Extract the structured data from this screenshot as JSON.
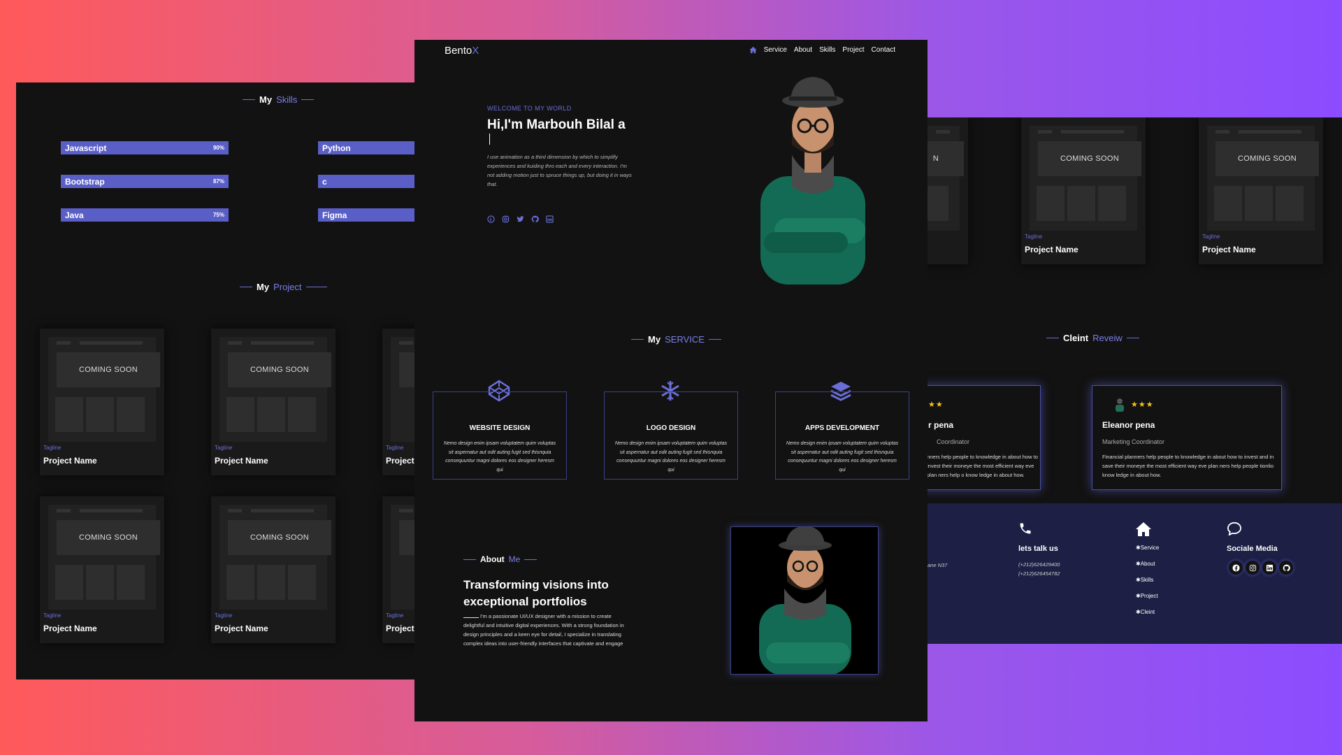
{
  "left": {
    "skills_title": {
      "prefix": "My",
      "accent": "Skills"
    },
    "skills": [
      {
        "label": "Javascript",
        "pct": "90%"
      },
      {
        "label": "Bootstrap",
        "pct": "87%"
      },
      {
        "label": "Java",
        "pct": "75%"
      },
      {
        "label": "Python",
        "pct": ""
      },
      {
        "label": "c",
        "pct": ""
      },
      {
        "label": "Figma",
        "pct": ""
      }
    ],
    "project_title": {
      "prefix": "My",
      "accent": "Project"
    },
    "card": {
      "coming_soon": "COMING SOON",
      "tagline": "Tagline",
      "name": "Project Name"
    }
  },
  "center": {
    "logo": {
      "main": "Bento",
      "accent": "X"
    },
    "nav": [
      "Service",
      "About",
      "Skills",
      "Project",
      "Contact"
    ],
    "welcome": "WELCOME TO MY WORLD",
    "hero_title": "Hi,I'm Marbouh Bilal a",
    "hero_desc": "I use animation as a third dimension by which to simplify experiences and kuiding thro each and every interaction. I'm not adding motion just to spruce things up, but doing it in ways that.",
    "service_title": {
      "prefix": "My",
      "accent": "SERVICE"
    },
    "services": [
      {
        "title": "WEBSITE DESIGN",
        "desc": "Nemo design enim ipsam voluptatem quim voluptas sit aspernatur aut odit auting fugit sed thisnquia consequuntur magni dolores eos designer heresm qui"
      },
      {
        "title": "LOGO DESIGN",
        "desc": "Nemo design enim ipsam voluptatem quim voluptas sit aspernatur aut odit auting fugit sed thisnquia consequuntur magni dolores eos designer heresm qui"
      },
      {
        "title": "APPS DEVELOPMENT",
        "desc": "Nemo design enim ipsam voluptatem quim voluptas sit aspernatur aut odit auting fugit sed thisnquia consequuntur magni dolores eos designer heresm qui"
      }
    ],
    "about_label": {
      "prefix": "About",
      "accent": "Me"
    },
    "about_title": "Transforming visions into exceptional portfolios",
    "about_desc": "I'm a passionate UI/UX designer with a mission to create delightful and intuitive digital experiences. With a strong foundation in design principles and a keen eye for detail, I specialize in translating complex ideas into user-friendly interfaces that captivate and engage"
  },
  "right": {
    "card": {
      "coming_soon": "COMING SOON",
      "tagline": "Tagline",
      "name": "Project Name",
      "partial_letter": "N"
    },
    "review_title": {
      "prefix": "Cleint",
      "accent": "Reveiw"
    },
    "reviews": [
      {
        "stars": "★★",
        "name": "r pena",
        "role": "Coordinator",
        "text": "nners help people to knowledge in about how to invest their moneye the most efficient way eve plan ners help o know ledge in about how."
      },
      {
        "stars": "★★★",
        "name": "Eleanor pena",
        "role": "Marketing Coordinator",
        "text": "Financial planners help people to knowledge in about how to invest and in save their moneye the most efficient way eve plan ners help people tionlio know ledge in about how."
      }
    ],
    "footer": {
      "address_partial": "ane N37",
      "contact_title": "lets talk us",
      "phones": [
        "(+212)626429400",
        "(+212)626454782"
      ],
      "links": [
        "Service",
        "About",
        "Skills",
        "Project",
        "Cleint"
      ],
      "social_title": "Sociale Media"
    }
  },
  "colors": {
    "accent": "#6a6fd8",
    "panel": "#121212",
    "footer": "#1d1f45",
    "star": "#f5c518"
  }
}
